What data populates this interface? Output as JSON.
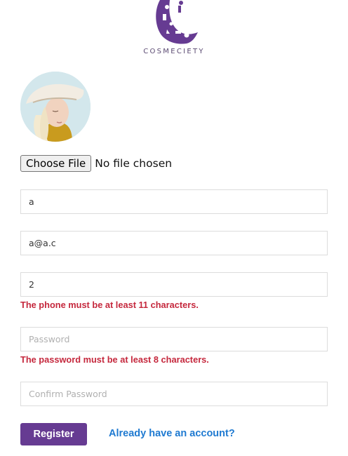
{
  "brand": {
    "logo_text": "COSMECIETY",
    "accent_color": "#663b92"
  },
  "avatar": {
    "icon": "profile-photo"
  },
  "file_upload": {
    "button_label": "Choose File",
    "status_text": "No file chosen"
  },
  "form": {
    "name": {
      "value": "a",
      "placeholder": ""
    },
    "email": {
      "value": "a@a.c",
      "placeholder": ""
    },
    "phone": {
      "value": "2",
      "placeholder": "",
      "error": "The phone must be at least 11 characters."
    },
    "password": {
      "value": "",
      "placeholder": "Password",
      "error": "The password must be at least 8 characters."
    },
    "confirm_password": {
      "value": "",
      "placeholder": "Confirm Password"
    }
  },
  "actions": {
    "register_label": "Register",
    "login_link_label": "Already have an account?"
  },
  "colors": {
    "error": "#c5283d",
    "link": "#1f7ad1"
  }
}
